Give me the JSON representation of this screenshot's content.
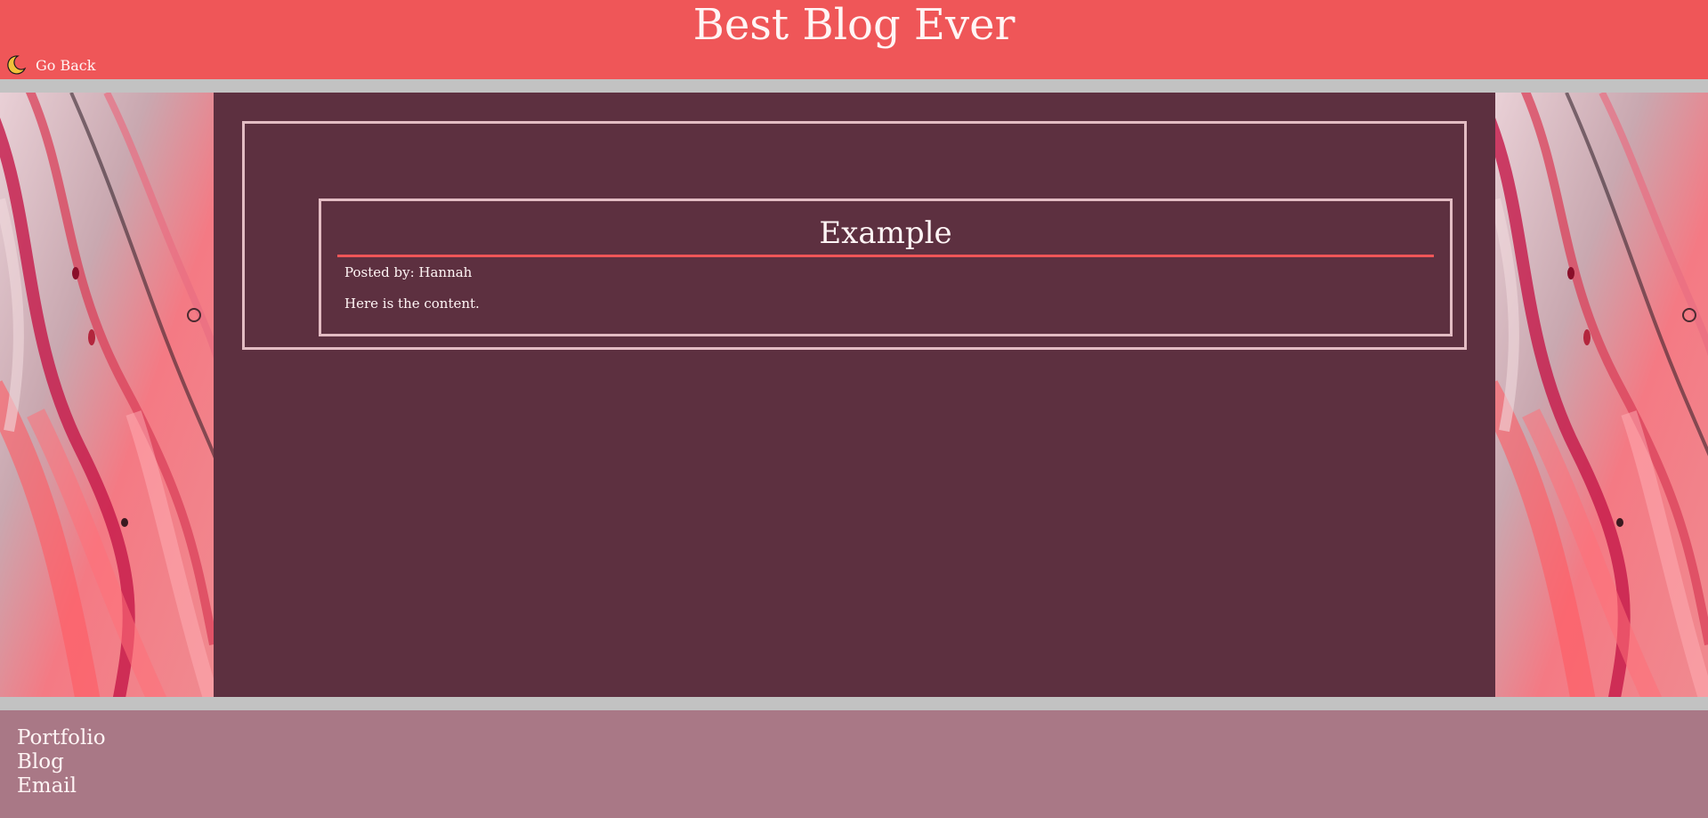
{
  "header": {
    "site_title": "Best Blog Ever",
    "go_back_label": "Go Back",
    "go_back_icon": "moon-icon",
    "background": "#ef5658"
  },
  "post": {
    "title": "Example",
    "author_line": "Posted by: Hannah",
    "content": "Here is the content."
  },
  "footer": {
    "links": [
      "Portfolio",
      "Blog",
      "Email"
    ],
    "background": "#a97886"
  },
  "colors": {
    "main_background": "#5d3040",
    "frame_border": "#e3bcc3",
    "accent_rule": "#ef5658",
    "text": "#fff5f5"
  }
}
